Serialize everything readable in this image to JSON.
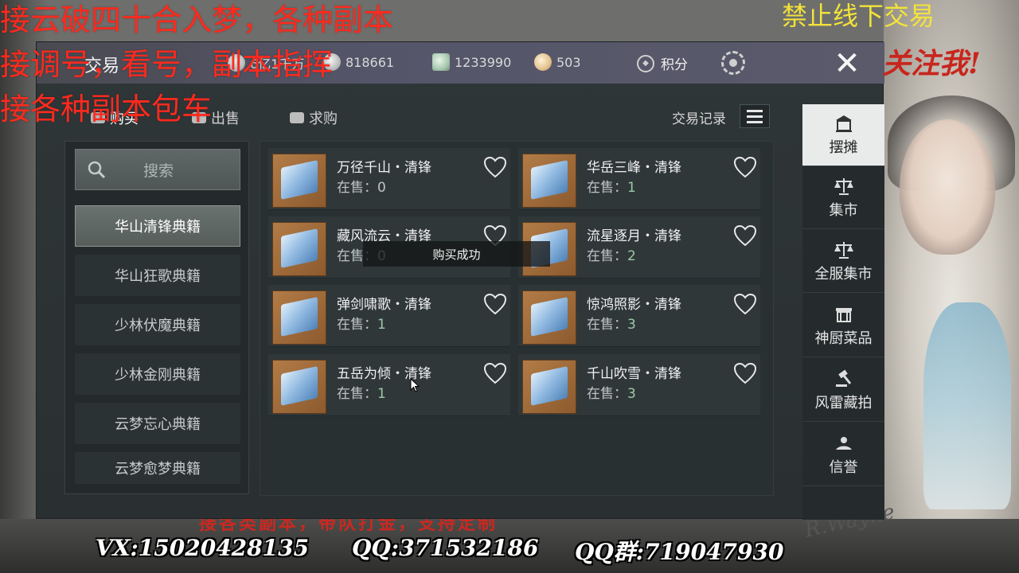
{
  "window": {
    "title": "交易"
  },
  "currencies": [
    {
      "icon": "silver-coin-icon",
      "value": "6亿1千万"
    },
    {
      "icon": "silver-ingot-icon",
      "value": "818661"
    },
    {
      "icon": "jade-icon",
      "value": "1233990"
    },
    {
      "icon": "money-bag-icon",
      "value": "503"
    }
  ],
  "points": {
    "label": "积分"
  },
  "subtabs": [
    {
      "label": "购买",
      "active": true
    },
    {
      "label": "出售",
      "active": false
    },
    {
      "label": "求购",
      "active": false
    }
  ],
  "trade_record": "交易记录",
  "search": {
    "placeholder": "搜索"
  },
  "categories": [
    {
      "label": "华山清锋典籍",
      "active": true
    },
    {
      "label": "华山狂歌典籍",
      "active": false
    },
    {
      "label": "少林伏魔典籍",
      "active": false
    },
    {
      "label": "少林金刚典籍",
      "active": false
    },
    {
      "label": "云梦忘心典籍",
      "active": false
    },
    {
      "label": "云梦愈梦典籍",
      "active": false
    }
  ],
  "items": [
    {
      "name": "万径千山・清锋",
      "stock_label": "在售：",
      "count": "0"
    },
    {
      "name": "华岳三峰・清锋",
      "stock_label": "在售：",
      "count": "1"
    },
    {
      "name": "藏风流云・清锋",
      "stock_label": "在售：",
      "count": "0"
    },
    {
      "name": "流星逐月・清锋",
      "stock_label": "在售：",
      "count": "2"
    },
    {
      "name": "弹剑啸歌・清锋",
      "stock_label": "在售：",
      "count": "1"
    },
    {
      "name": "惊鸿照影・清锋",
      "stock_label": "在售：",
      "count": "3"
    },
    {
      "name": "五岳为倾・清锋",
      "stock_label": "在售：",
      "count": "1"
    },
    {
      "name": "千山吹雪・清锋",
      "stock_label": "在售：",
      "count": "3"
    }
  ],
  "toast": "购买成功",
  "right_nav": [
    {
      "label": "摆摊",
      "icon": "stall-icon",
      "active": true
    },
    {
      "label": "集市",
      "icon": "scale-icon",
      "active": false
    },
    {
      "label": "全服集市",
      "icon": "scale-icon",
      "active": false
    },
    {
      "label": "神厨菜品",
      "icon": "kitchen-icon",
      "active": false
    },
    {
      "label": "风雷藏拍",
      "icon": "auction-hammer-icon",
      "active": false
    },
    {
      "label": "信誉",
      "icon": "reputation-icon",
      "active": false
    }
  ],
  "overlays": {
    "red_lines": [
      "接云破四十合入梦，各种副本",
      "接调号，看号，副本指挥",
      "接各种副本包车"
    ],
    "yellow_line": "禁止线下交易",
    "follow": "关注我!",
    "bottom_banner": "接各类副本，带队打金，支持定制",
    "contacts": [
      "VX:15020428135",
      "QQ:371532186",
      "QQ群:719047930"
    ]
  },
  "colors": {
    "accent_green": "#9ec9a6",
    "overlay_red": "#ff2a1e",
    "overlay_yellow": "#f4e23a"
  }
}
